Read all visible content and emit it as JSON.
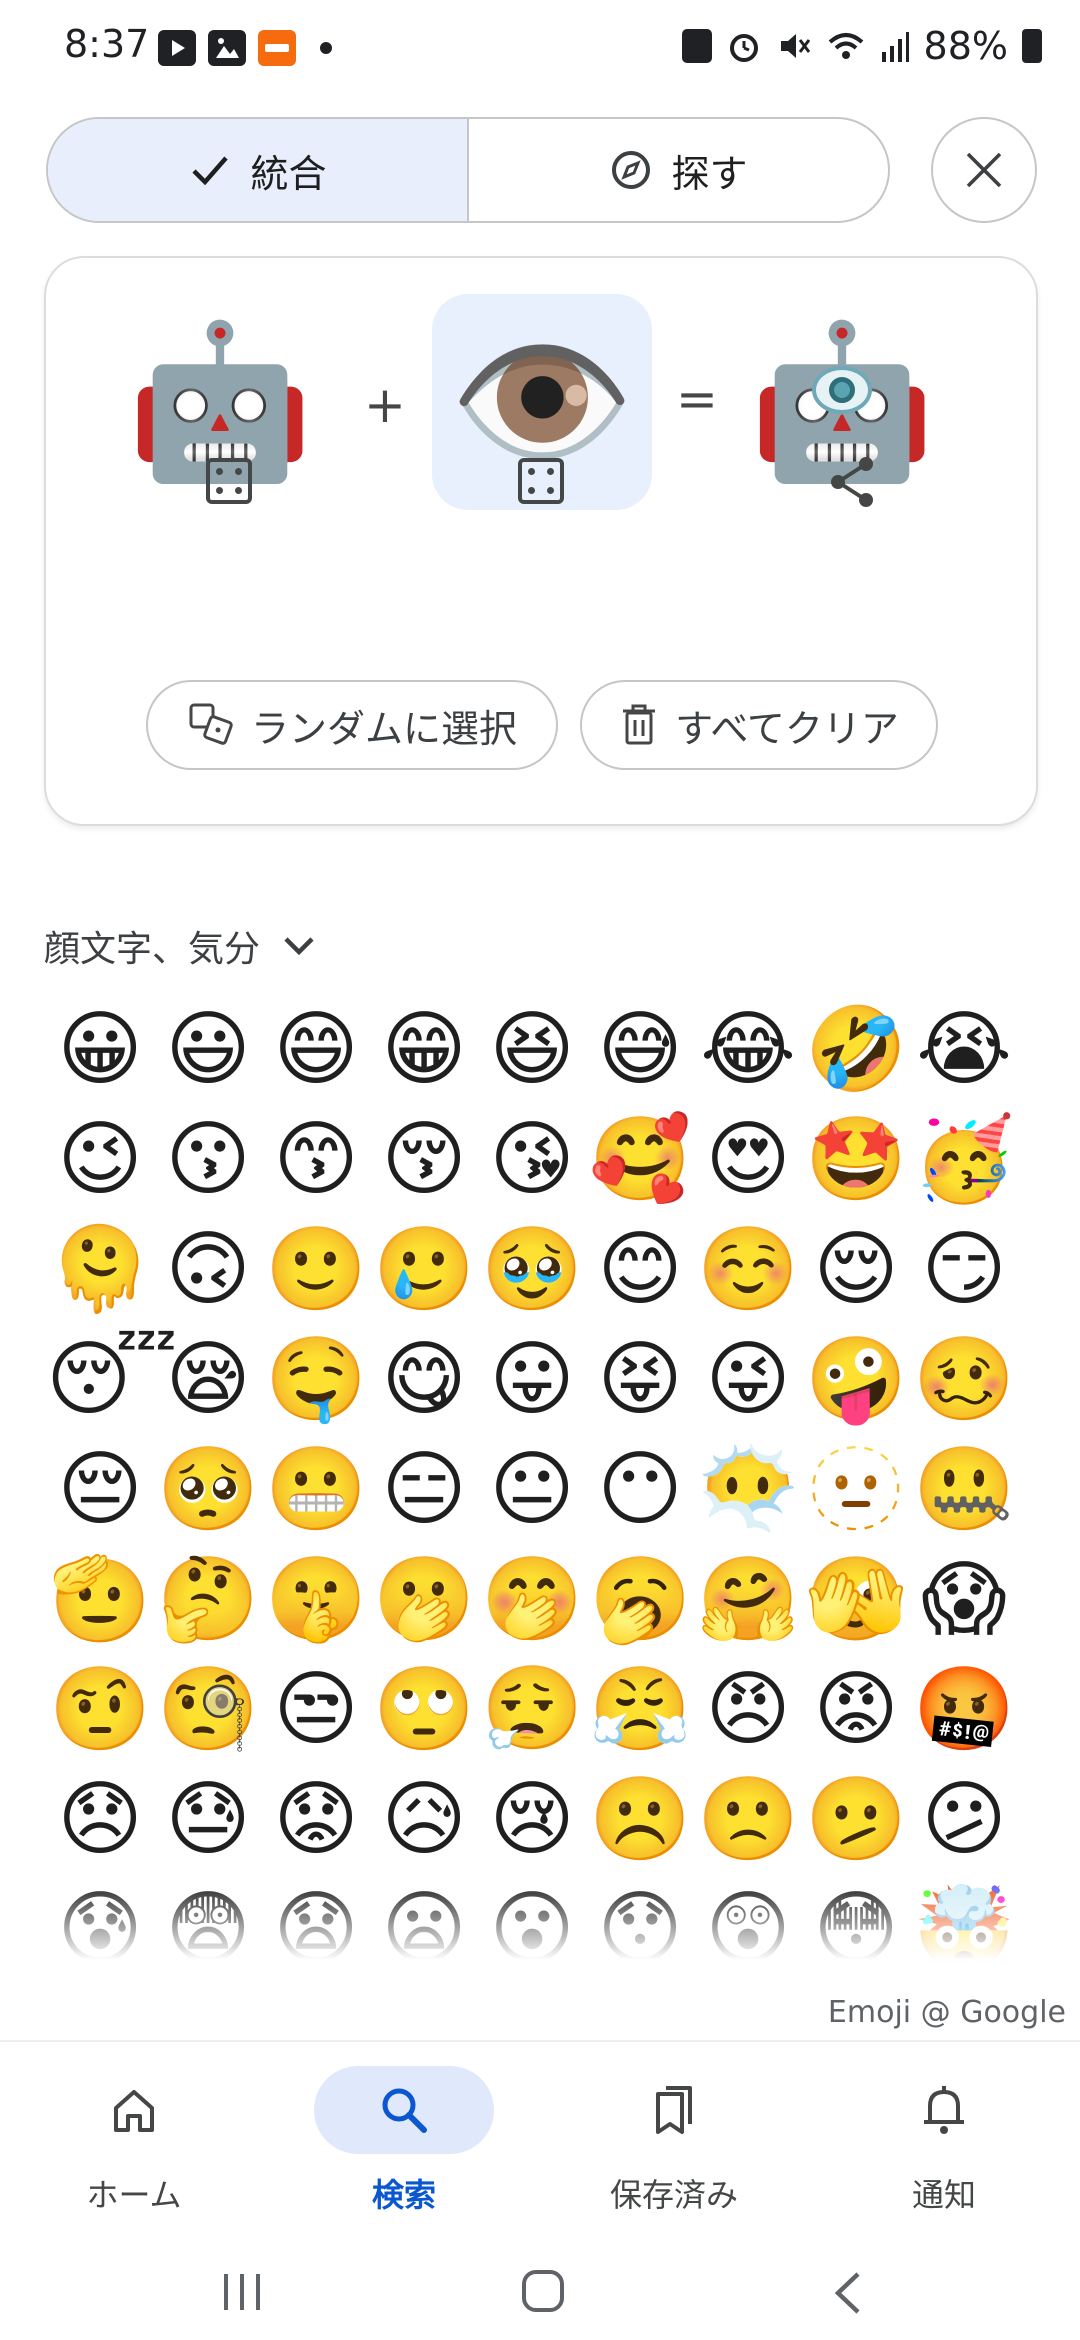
{
  "status_bar": {
    "time": "8:37",
    "battery": "88%",
    "left_icons": [
      "youtube-icon",
      "gallery-icon",
      "temu-icon",
      "dot-icon"
    ],
    "right_icons": [
      "battery-saver-icon",
      "alarm-icon",
      "mute-icon",
      "wifi-icon",
      "signal-icon",
      "battery-icon"
    ]
  },
  "tabs": {
    "mix_label": "統合",
    "browse_label": "探す"
  },
  "mixer": {
    "left_emoji": "🤖",
    "right_emoji": "👁️",
    "result_emoji": "🤖",
    "plus": "+",
    "equals": "=",
    "random_label": "ランダムに選択",
    "clear_label": "すべてクリア"
  },
  "category": {
    "label": "顔文字、気分"
  },
  "emoji_grid": [
    "😀",
    "😃",
    "😄",
    "😁",
    "😆",
    "😅",
    "😂",
    "🤣",
    "😭",
    "😉",
    "😗",
    "😙",
    "😚",
    "😘",
    "🥰",
    "😍",
    "🤩",
    "🥳",
    "🫠",
    "🙃",
    "🙂",
    "🥲",
    "🥹",
    "😊",
    "☺️",
    "😌",
    "😏",
    "😴",
    "😪",
    "🤤",
    "😋",
    "😛",
    "😝",
    "😜",
    "🤪",
    "🥴",
    "😔",
    "🥺",
    "😬",
    "😑",
    "😐",
    "😶",
    "😶‍🌫️",
    "🫥",
    "🤐",
    "🫡",
    "🤔",
    "🤫",
    "🫢",
    "🤭",
    "🥱",
    "🤗",
    "🫣",
    "😱",
    "🤨",
    "🧐",
    "😒",
    "🙄",
    "😮‍💨",
    "😤",
    "😠",
    "😡",
    "🤬",
    "😞",
    "😓",
    "😟",
    "😥",
    "😢",
    "☹️",
    "🙁",
    "🫤",
    "😕",
    "😰",
    "😨",
    "😧",
    "😦",
    "😮",
    "😯",
    "😲",
    "😳",
    "🤯"
  ],
  "credit": "Emoji @ Google",
  "bottom_nav": {
    "home": "ホーム",
    "search": "検索",
    "saved": "保存済み",
    "notifications": "通知"
  },
  "colors": {
    "accent": "#0b57d0",
    "active_tab_bg": "#e8eefc",
    "selected_slot_bg": "#e8effd",
    "temu_orange": "#f56b0e"
  }
}
